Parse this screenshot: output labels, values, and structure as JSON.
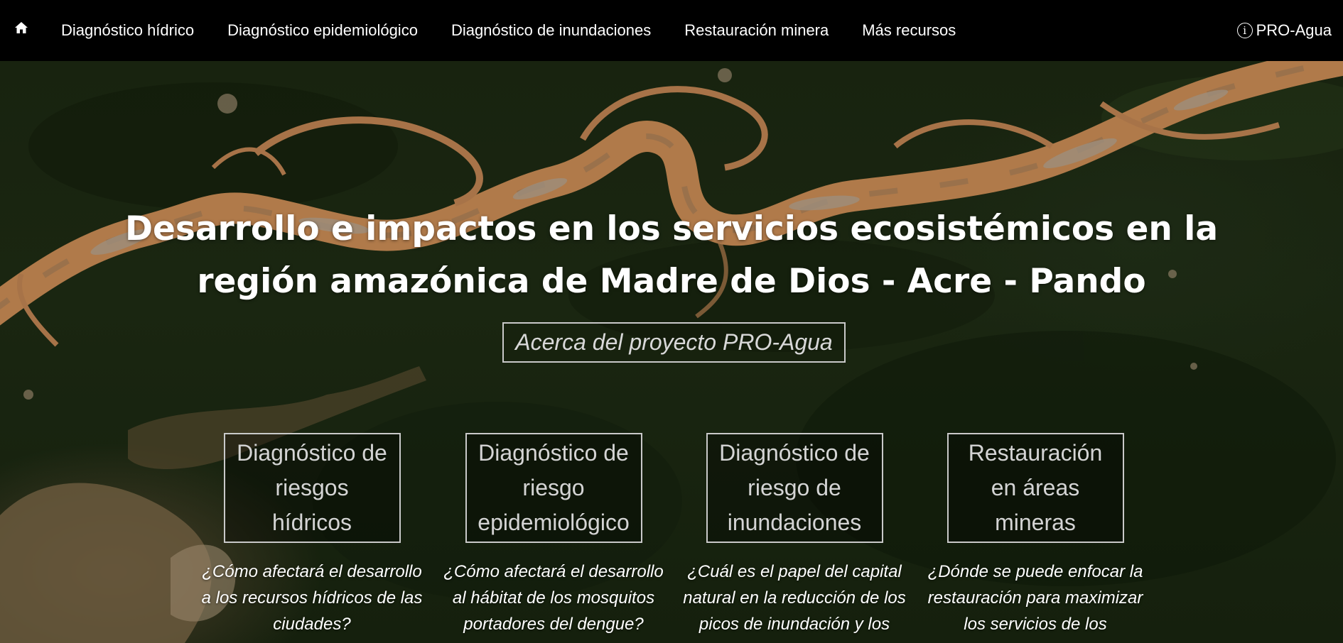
{
  "nav": {
    "home_icon": "home-icon",
    "links": [
      "Diagnóstico hídrico",
      "Diagnóstico epidemiológico",
      "Diagnóstico de inundaciones",
      "Restauración minera",
      "Más recursos"
    ],
    "brand_icon": "info-icon",
    "brand_label": "PRO-Agua"
  },
  "hero": {
    "title_line1": "Desarrollo e impactos en los servicios ecosistémicos en la",
    "title_line2": "región amazónica de Madre de Dios - Acre - Pando",
    "about_button": "Acerca del proyecto PRO-Agua"
  },
  "cards": [
    {
      "title_lines": [
        "Diagnóstico de",
        "riesgos",
        "hídricos"
      ],
      "question_lines": [
        "¿Cómo afectará el desarrollo",
        "a los recursos hídricos de las",
        "ciudades?"
      ]
    },
    {
      "title_lines": [
        "Diagnóstico de",
        "riesgo",
        "epidemiológico"
      ],
      "question_lines": [
        "¿Cómo afectará el desarrollo",
        "al hábitat de los mosquitos",
        "portadores del dengue?"
      ]
    },
    {
      "title_lines": [
        "Diagnóstico de",
        "riesgo de",
        "inundaciones"
      ],
      "question_lines": [
        "¿Cuál es el papel del capital",
        "natural en la reducción de los",
        "picos de inundación y los"
      ]
    },
    {
      "title_lines": [
        "Restauración",
        "en áreas",
        "mineras"
      ],
      "question_lines": [
        "¿Dónde se puede enfocar la",
        "restauración para maximizar",
        "los servicios de los"
      ]
    }
  ],
  "colors": {
    "navbar_bg": "#000000",
    "forest": "#1a2611",
    "river": "#b07a4a",
    "card_border": "#c9c9c9"
  }
}
